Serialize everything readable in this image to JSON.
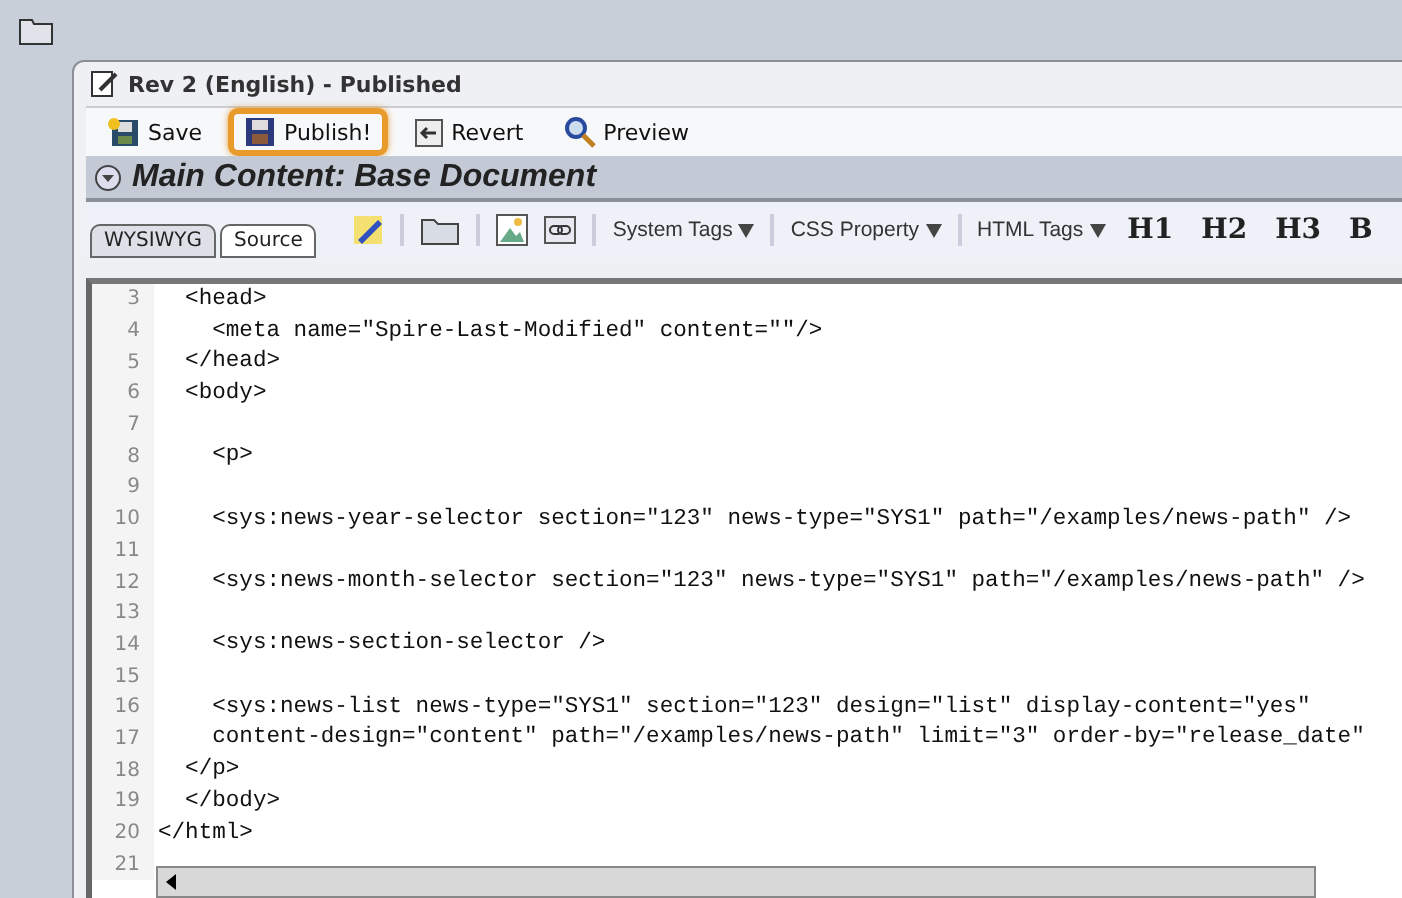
{
  "window": {
    "title": "Rev 2 (English) - Published"
  },
  "toolbar": [
    {
      "label": "Save",
      "kind": "save",
      "highlighted": false
    },
    {
      "label": "Publish!",
      "kind": "publish",
      "highlighted": true
    },
    {
      "label": "Revert",
      "kind": "revert",
      "highlighted": false
    },
    {
      "label": "Preview",
      "kind": "preview",
      "highlighted": false
    }
  ],
  "section": {
    "title": "Main Content: Base Document"
  },
  "tabs": [
    {
      "label": "WYSIWYG",
      "selected": false
    },
    {
      "label": "Source",
      "selected": true
    }
  ],
  "editor_tools": [
    {
      "kind": "pencil"
    },
    {
      "kind": "sep"
    },
    {
      "kind": "folder"
    },
    {
      "kind": "sep"
    },
    {
      "kind": "image"
    },
    {
      "kind": "link"
    },
    {
      "kind": "sep"
    },
    {
      "kind": "dropdown",
      "label": "System Tags"
    },
    {
      "kind": "sep"
    },
    {
      "kind": "dropdown",
      "label": "CSS Property"
    },
    {
      "kind": "sep"
    },
    {
      "kind": "dropdown",
      "label": "HTML Tags"
    },
    {
      "kind": "format",
      "label": "H1"
    },
    {
      "kind": "format",
      "label": "H2"
    },
    {
      "kind": "format",
      "label": "H3"
    },
    {
      "kind": "format",
      "label": "B"
    }
  ],
  "code": [
    {
      "number": "3",
      "text": "  <head>"
    },
    {
      "number": "4",
      "text": "    <meta name=\"Spire-Last-Modified\" content=\"\"/>"
    },
    {
      "number": "5",
      "text": "  </head>"
    },
    {
      "number": "6",
      "text": "  <body>"
    },
    {
      "number": "7"
    },
    {
      "number": "8",
      "text": "    <p>"
    },
    {
      "number": "9"
    },
    {
      "number": "10",
      "text": "    <sys:news-year-selector section=\"123\" news-type=\"SYS1\" path=\"/examples/news-path\" />"
    },
    {
      "number": "11"
    },
    {
      "number": "12",
      "text": "    <sys:news-month-selector section=\"123\" news-type=\"SYS1\" path=\"/examples/news-path\" />"
    },
    {
      "number": "13"
    },
    {
      "number": "14",
      "text": "    <sys:news-section-selector />"
    },
    {
      "number": "15"
    },
    {
      "number": "16",
      "text": "    <sys:news-list news-type=\"SYS1\" section=\"123\" design=\"list\" display-content=\"yes\""
    },
    {
      "number": "17",
      "text": "    content-design=\"content\" path=\"/examples/news-path\" limit=\"3\" order-by=\"release_date\""
    },
    {
      "number": "18",
      "text": "  </p>"
    },
    {
      "number": "19",
      "text": "  </body>"
    },
    {
      "number": "20",
      "text": "</html>"
    },
    {
      "number": "21"
    }
  ]
}
